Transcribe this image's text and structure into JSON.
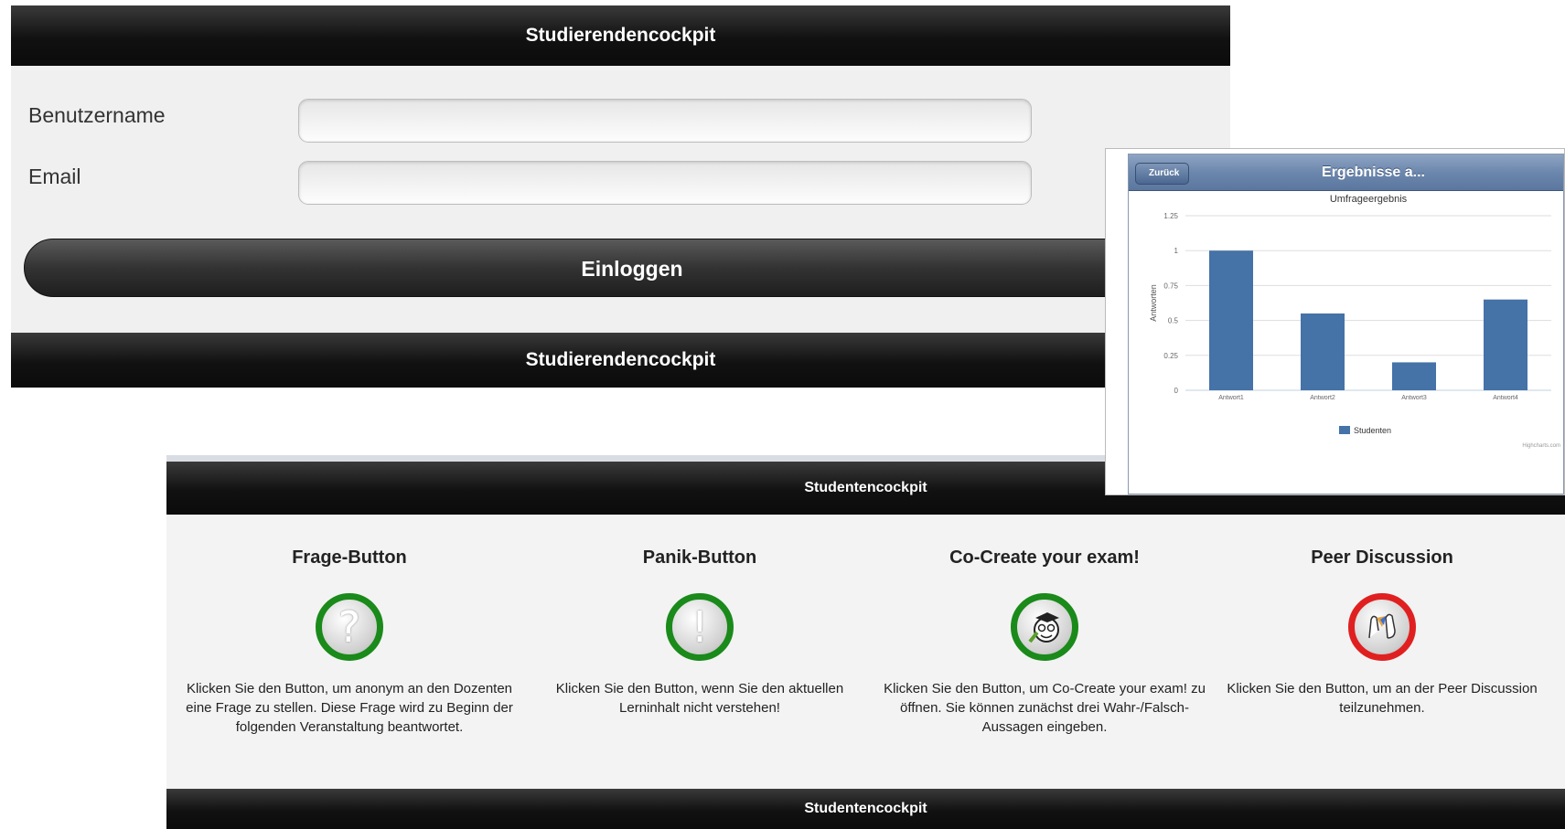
{
  "login": {
    "header_title": "Studierendencockpit",
    "username_label": "Benutzername",
    "email_label": "Email",
    "username_value": "",
    "email_value": "",
    "login_button": "Einloggen",
    "footer_title": "Studierendencockpit"
  },
  "results": {
    "back_button": "Zurück",
    "nav_title": "Ergebnisse a...",
    "credit": "Highcharts.com"
  },
  "chart_data": {
    "type": "bar",
    "title": "Umfrageergebnis",
    "ylabel": "Antworten",
    "xlabel": "",
    "categories": [
      "Antwort1",
      "Antwort2",
      "Antwort3",
      "Antwort4"
    ],
    "series": [
      {
        "name": "Studenten",
        "values": [
          1,
          0.55,
          0.2,
          0.65
        ]
      }
    ],
    "ylim": [
      0,
      1.25
    ],
    "yticks": [
      "0",
      "0.25",
      "0.5",
      "0.75",
      "1",
      "1.25"
    ],
    "grid": true,
    "legend": "bottom-center",
    "bar_color": "#4572A7"
  },
  "dashboard": {
    "header_title": "Studentencockpit",
    "footer_title": "Studentencockpit",
    "cards": [
      {
        "title": "Frage-Button",
        "icon": "question-icon",
        "text": "Klicken Sie den Button, um anonym an den Dozenten eine Frage zu stellen. Diese Frage wird zu Beginn der folgenden Veranstaltung beantwortet."
      },
      {
        "title": "Panik-Button",
        "icon": "exclamation-icon",
        "text": "Klicken Sie den Button, wenn Sie den aktuellen Lerninhalt nicht verstehen!"
      },
      {
        "title": "Co-Create your exam!",
        "icon": "exam-icon",
        "text": "Klicken Sie den Button, um Co-Create your exam! zu öffnen. Sie können zunächst drei Wahr-/Falsch-Aussagen eingeben."
      },
      {
        "title": "Peer Discussion",
        "icon": "discussion-icon",
        "text": "Klicken Sie den Button, um an der Peer Discussion teilzunehmen."
      }
    ]
  },
  "colors": {
    "green_ring": "#1a8a1a",
    "red_ring": "#e02020",
    "bar_dark": "#111111"
  }
}
